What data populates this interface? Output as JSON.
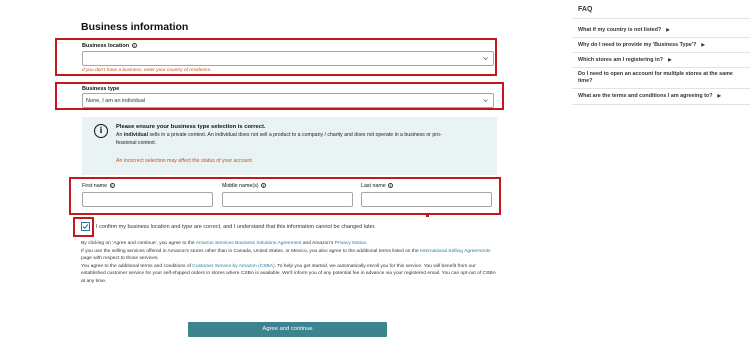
{
  "page": {
    "title": "Business information"
  },
  "business_location": {
    "label": "Business location",
    "value": "",
    "hint": "If you don't have a business, enter your country of residence."
  },
  "business_type": {
    "label": "Business type",
    "value": "None, I am an individual"
  },
  "notice": {
    "title": "Please ensure your business type selection is correct.",
    "line1_prefix": "An ",
    "line1_bold": "individual",
    "line1_rest": " sells in a private context. An individual does not sell a product to a company / charity and does not operate in a business or pro-",
    "line2": "fessional context.",
    "warning": "An incorrect selection may affect the status of your account."
  },
  "name_fields": {
    "first_label": "First name",
    "middle_label": "Middle name(s)",
    "last_label": "Last name"
  },
  "confirm": {
    "checked": true,
    "text": "I confirm my business location and type are correct, and I understand that this information cannot be changed later."
  },
  "legal": {
    "p1_a": "By clicking on 'Agree and continue', you agree to the ",
    "p1_link1": "Amazon Services Business Solutions Agreement",
    "p1_b": " and Amazon's ",
    "p1_link2": "Privacy Notice",
    "p1_c": ".",
    "p2_a": "If you use the selling services offered in Amazon's stores other than in Canada, United States, or Mexico, you also agree to the additional terms listed on the ",
    "p2_link": "International Selling Agreements",
    "p2_b": " page with respect to those services.",
    "p3_a": "You agree to the additional terms and conditions of ",
    "p3_link": "Customer Service by Amazon (CSBA)",
    "p3_b": ". To help you get started, we automatically enroll you for this service. You will benefit from our established customer service for your self-shipped orders in stores where CSBA is available. We'll inform you of any potential fee in advance via your registered email. You can opt-out of CSBA at any time."
  },
  "cta": {
    "label": "Agree and continue"
  },
  "faq": {
    "title": "FAQ",
    "items": [
      "What if my country is not listed?",
      "Why do I need to provide my 'Business Type'?",
      "Which stores am I registering in?",
      "Do I need to open an account for multiple stores at the same",
      "time?",
      "What are the terms and conditions I am agreeing to?"
    ]
  },
  "colors": {
    "annotation_red": "#c4161c",
    "cta_teal": "#3d8491",
    "link_teal": "#2a7c99",
    "warning_orange": "#c7511f",
    "panel_bg": "#e9f3f3"
  }
}
